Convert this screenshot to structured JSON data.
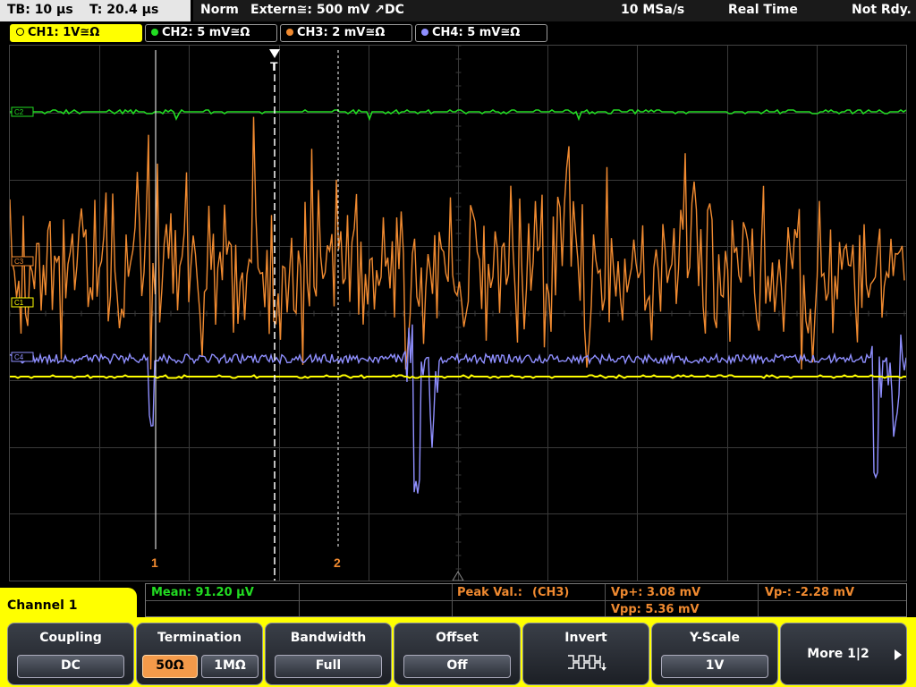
{
  "status": {
    "timebase": "TB: 10 µs",
    "trigger_time": "T: 20.4 µs",
    "mode": "Norm",
    "trigger_source": "Extern≅: 500 mV ↗DC",
    "sample_rate": "10 MSa/s",
    "acq_mode": "Real Time",
    "state": "Not Rdy."
  },
  "channels": [
    {
      "label": "CH1: 1V≅Ω",
      "color": "#ffff00"
    },
    {
      "label": "CH2: 5 mV≅Ω",
      "color": "#22dd22"
    },
    {
      "label": "CH3: 2 mV≅Ω",
      "color": "#f08a30"
    },
    {
      "label": "CH4: 5 mV≅Ω",
      "color": "#8f8fff"
    }
  ],
  "screen": {
    "trigger_marker": "T",
    "cursor1_label": "1",
    "cursor2_label": "2",
    "ch_markers": {
      "ch2": "C2",
      "ch3": "C3",
      "ch1": "C1",
      "ch4": "C4"
    }
  },
  "measurements": {
    "mean": "Mean: 91.20 µV",
    "peak_label": "Peak Val.:",
    "peak_channel": "(CH3)",
    "vp_plus": "Vp+: 3.08 mV",
    "vp_minus": "Vp-: -2.28 mV",
    "vpp": "Vpp: 5.36 mV"
  },
  "menu": {
    "title": "Channel 1",
    "coupling": {
      "label": "Coupling",
      "value": "DC"
    },
    "termination": {
      "label": "Termination",
      "option1": "50Ω",
      "option2": "1MΩ",
      "selected": "50Ω"
    },
    "bandwidth": {
      "label": "Bandwidth",
      "value": "Full"
    },
    "offset": {
      "label": "Offset",
      "value": "Off"
    },
    "invert": {
      "label": "Invert"
    },
    "yscale": {
      "label": "Y-Scale",
      "value": "1V"
    },
    "more": {
      "label": "More 1|2"
    }
  }
}
